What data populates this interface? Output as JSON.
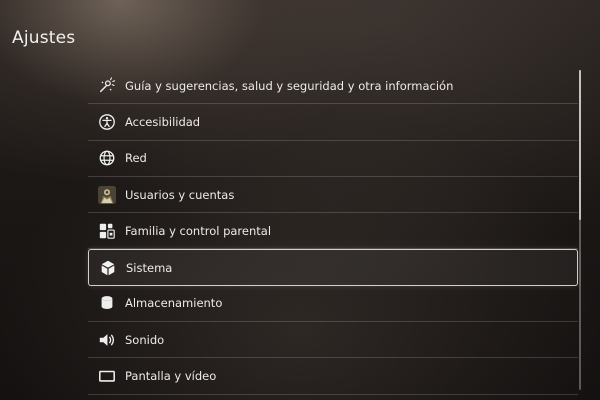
{
  "header": {
    "title": "Ajustes"
  },
  "settings": {
    "items": [
      {
        "label": "Guía y sugerencias, salud y seguridad y otra información",
        "icon": "tips-icon",
        "selected": false
      },
      {
        "label": "Accesibilidad",
        "icon": "accessibility-icon",
        "selected": false
      },
      {
        "label": "Red",
        "icon": "globe-icon",
        "selected": false
      },
      {
        "label": "Usuarios y cuentas",
        "icon": "user-avatar-icon",
        "selected": false
      },
      {
        "label": "Familia y control parental",
        "icon": "family-icon",
        "selected": false
      },
      {
        "label": "Sistema",
        "icon": "cube-icon",
        "selected": true
      },
      {
        "label": "Almacenamiento",
        "icon": "storage-icon",
        "selected": false
      },
      {
        "label": "Sonido",
        "icon": "speaker-icon",
        "selected": false
      },
      {
        "label": "Pantalla y vídeo",
        "icon": "display-icon",
        "selected": false
      }
    ]
  },
  "colors": {
    "background_dark": "#141110",
    "background_light": "#2a2421",
    "text": "#ecebe8",
    "divider": "rgba(255,255,255,0.16)",
    "selection_border": "#f5f5f5"
  }
}
